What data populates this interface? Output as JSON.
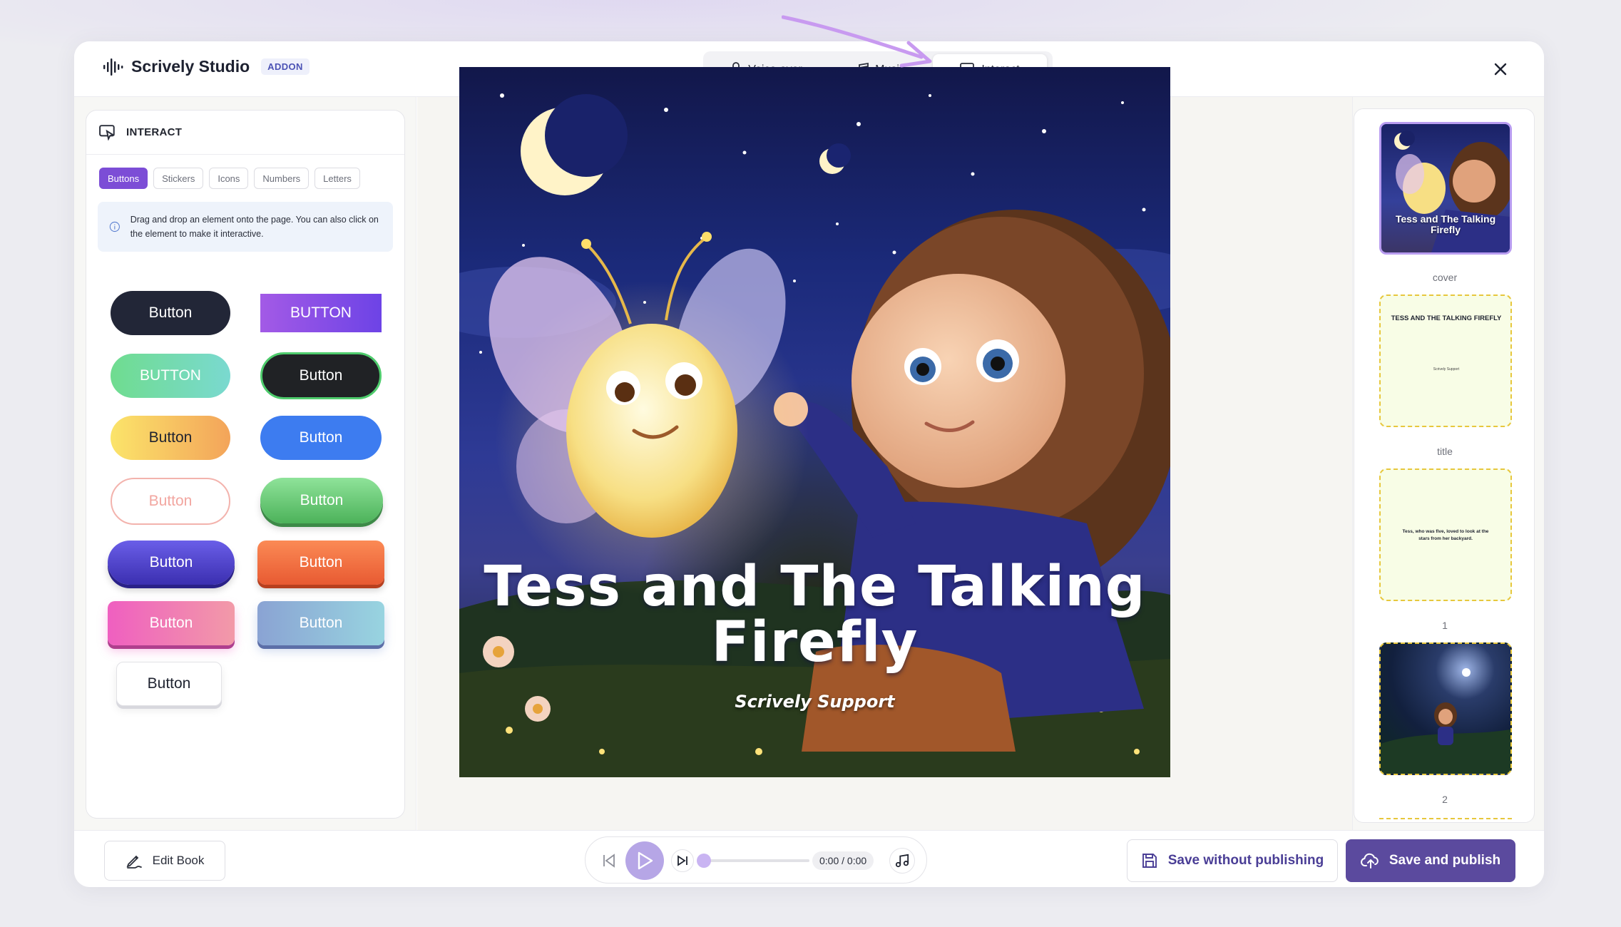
{
  "app": {
    "title": "Scrively Studio",
    "badge": "ADDON"
  },
  "tabs": [
    {
      "label": "Voice-over",
      "icon": "microphone-icon"
    },
    {
      "label": "Music",
      "icon": "music-note-icon"
    },
    {
      "label": "Interact",
      "icon": "interact-icon",
      "active": true
    }
  ],
  "panel": {
    "title": "INTERACT",
    "chips": [
      {
        "label": "Buttons",
        "active": true
      },
      {
        "label": "Stickers"
      },
      {
        "label": "Icons"
      },
      {
        "label": "Numbers"
      },
      {
        "label": "Letters"
      }
    ],
    "info": "Drag and drop an element onto the page. You can also click on the element to make it interactive.",
    "buttons": [
      "Button",
      "BUTTON",
      "BUTTON",
      "Button",
      "Button",
      "Button",
      "Button",
      "Button",
      "Button",
      "Button",
      "Button",
      "Button",
      "Button"
    ]
  },
  "cover": {
    "title_line1": "Tess and The Talking",
    "title_line2": "Firefly",
    "author": "Scrively Support"
  },
  "thumbnails": {
    "cover_label": "cover",
    "cover_title": "Tess and The Talking Firefly",
    "title_label": "title",
    "title_heading": "TESS AND THE TALKING FIREFLY",
    "title_author": "Scrively Support",
    "page1_label": "1",
    "page1_text": "Tess, who was five, loved to look at the stars from her backyard.",
    "page2_label": "2"
  },
  "footer": {
    "edit_label": "Edit Book",
    "time": "0:00 / 0:00",
    "progress": 0,
    "save_draft_label": "Save without publishing",
    "save_publish_label": "Save and publish"
  },
  "colors": {
    "accent": "#7c4dd6",
    "publish": "#5b4a9e",
    "play": "#b6a6e6"
  }
}
